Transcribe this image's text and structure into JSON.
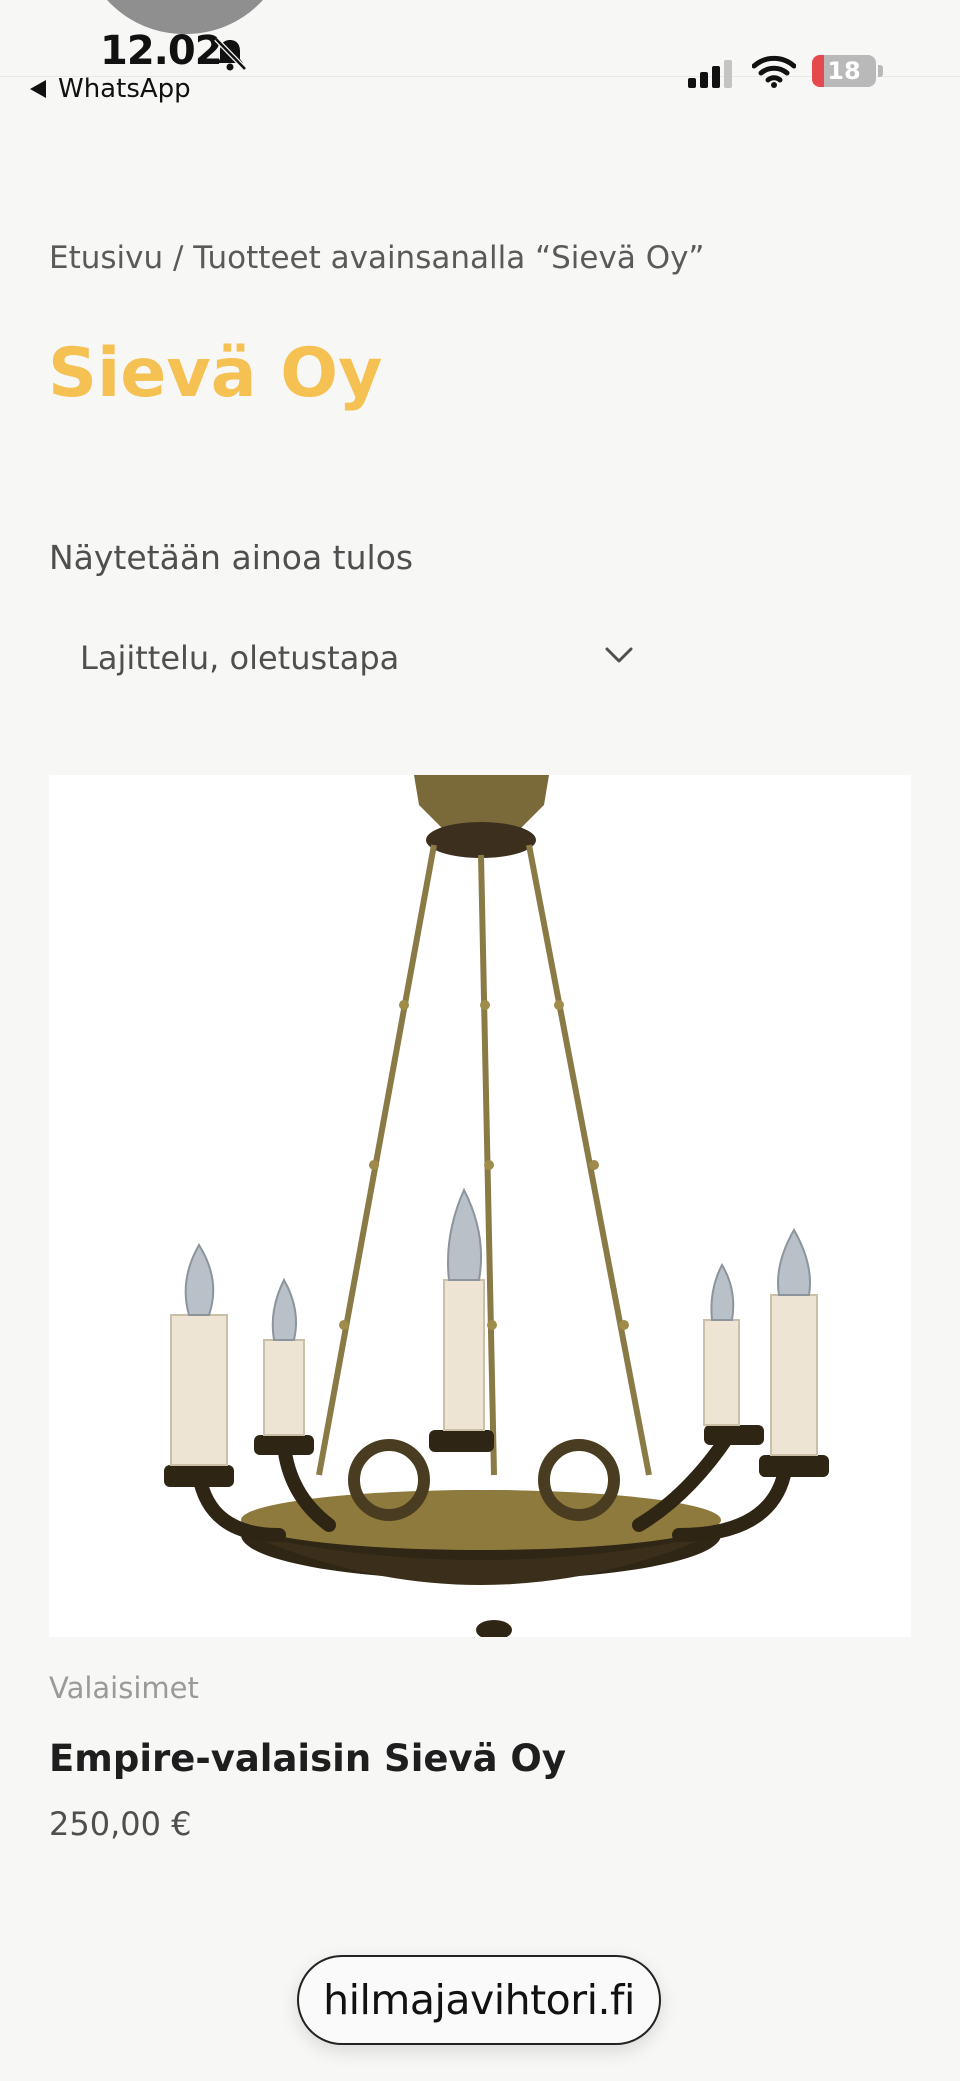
{
  "status_bar": {
    "time": "12.02",
    "back_app": "WhatsApp",
    "battery_level": "18",
    "icons": [
      "bell-slash-icon",
      "signal-icon",
      "wifi-icon",
      "battery-icon"
    ]
  },
  "breadcrumb": "Etusivu / Tuotteet avainsanalla “Sievä Oy”",
  "page_title": "Sievä Oy",
  "result_count": "Näytetään ainoa tulos",
  "sort": {
    "selected": "Lajittelu, oletustapa"
  },
  "product": {
    "category": "Valaisimet",
    "name": "Empire-valaisin Sievä Oy",
    "price": "250,00 €",
    "image_subject": "brass empire chandelier"
  },
  "browser": {
    "url": "hilmajavihtori.fi"
  },
  "colors": {
    "background": "#f7f7f5",
    "title_accent": "#f4c152",
    "battery_low": "#e5484d",
    "text": "#4f4f4f"
  }
}
